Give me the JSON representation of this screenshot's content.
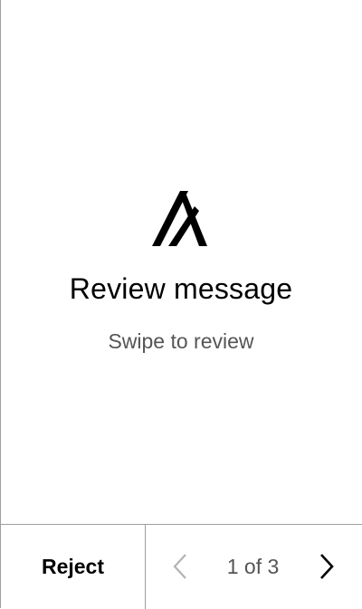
{
  "screen": {
    "title": "Review message",
    "subtitle": "Swipe to review",
    "logo_icon": "algorand-logo-icon"
  },
  "footer": {
    "reject_label": "Reject",
    "page_indicator": "1 of 3",
    "prev_icon": "chevron-left-icon",
    "next_icon": "chevron-right-icon",
    "prev_enabled": false,
    "next_enabled": true
  },
  "colors": {
    "text_primary": "#000000",
    "text_secondary": "#555555",
    "border": "#9e9e9e",
    "disabled_icon": "#b3b3b3",
    "background": "#ffffff"
  }
}
